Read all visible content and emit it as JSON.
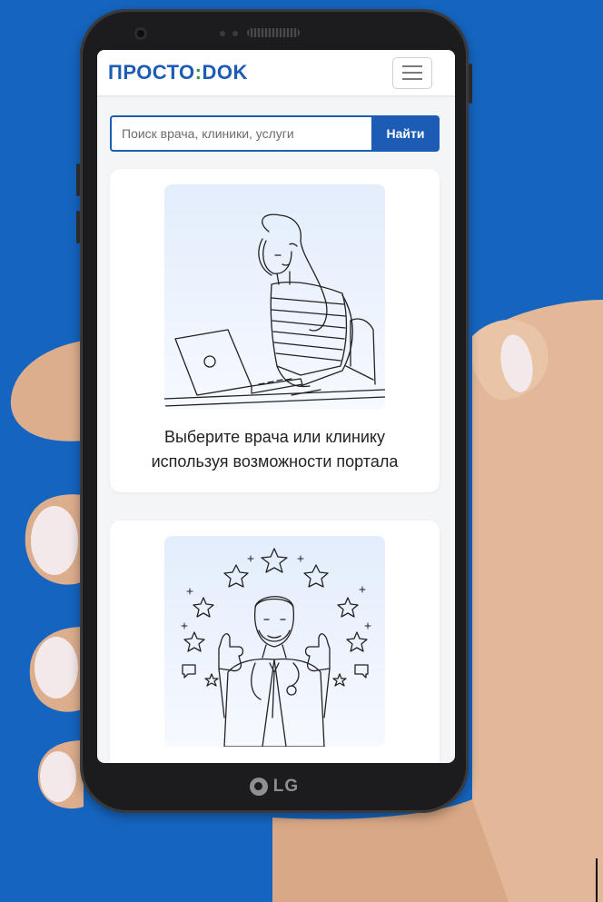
{
  "brand": {
    "part1": "ПРОСТО",
    "colon": ":",
    "part2": "DOK"
  },
  "search": {
    "placeholder": "Поиск врача, клиники, услуги",
    "button_label": "Найти"
  },
  "cards": [
    {
      "line1": "Выберите врача или клинику",
      "line2": "используя возможности портала",
      "illustration": "woman-at-laptop-illustration"
    },
    {
      "illustration": "doctor-with-stars-illustration"
    }
  ],
  "device": {
    "logo_text": "LG"
  },
  "colors": {
    "background": "#1565c0",
    "brand_blue": "#1c5cb5",
    "brand_green": "#2e9b3f"
  }
}
